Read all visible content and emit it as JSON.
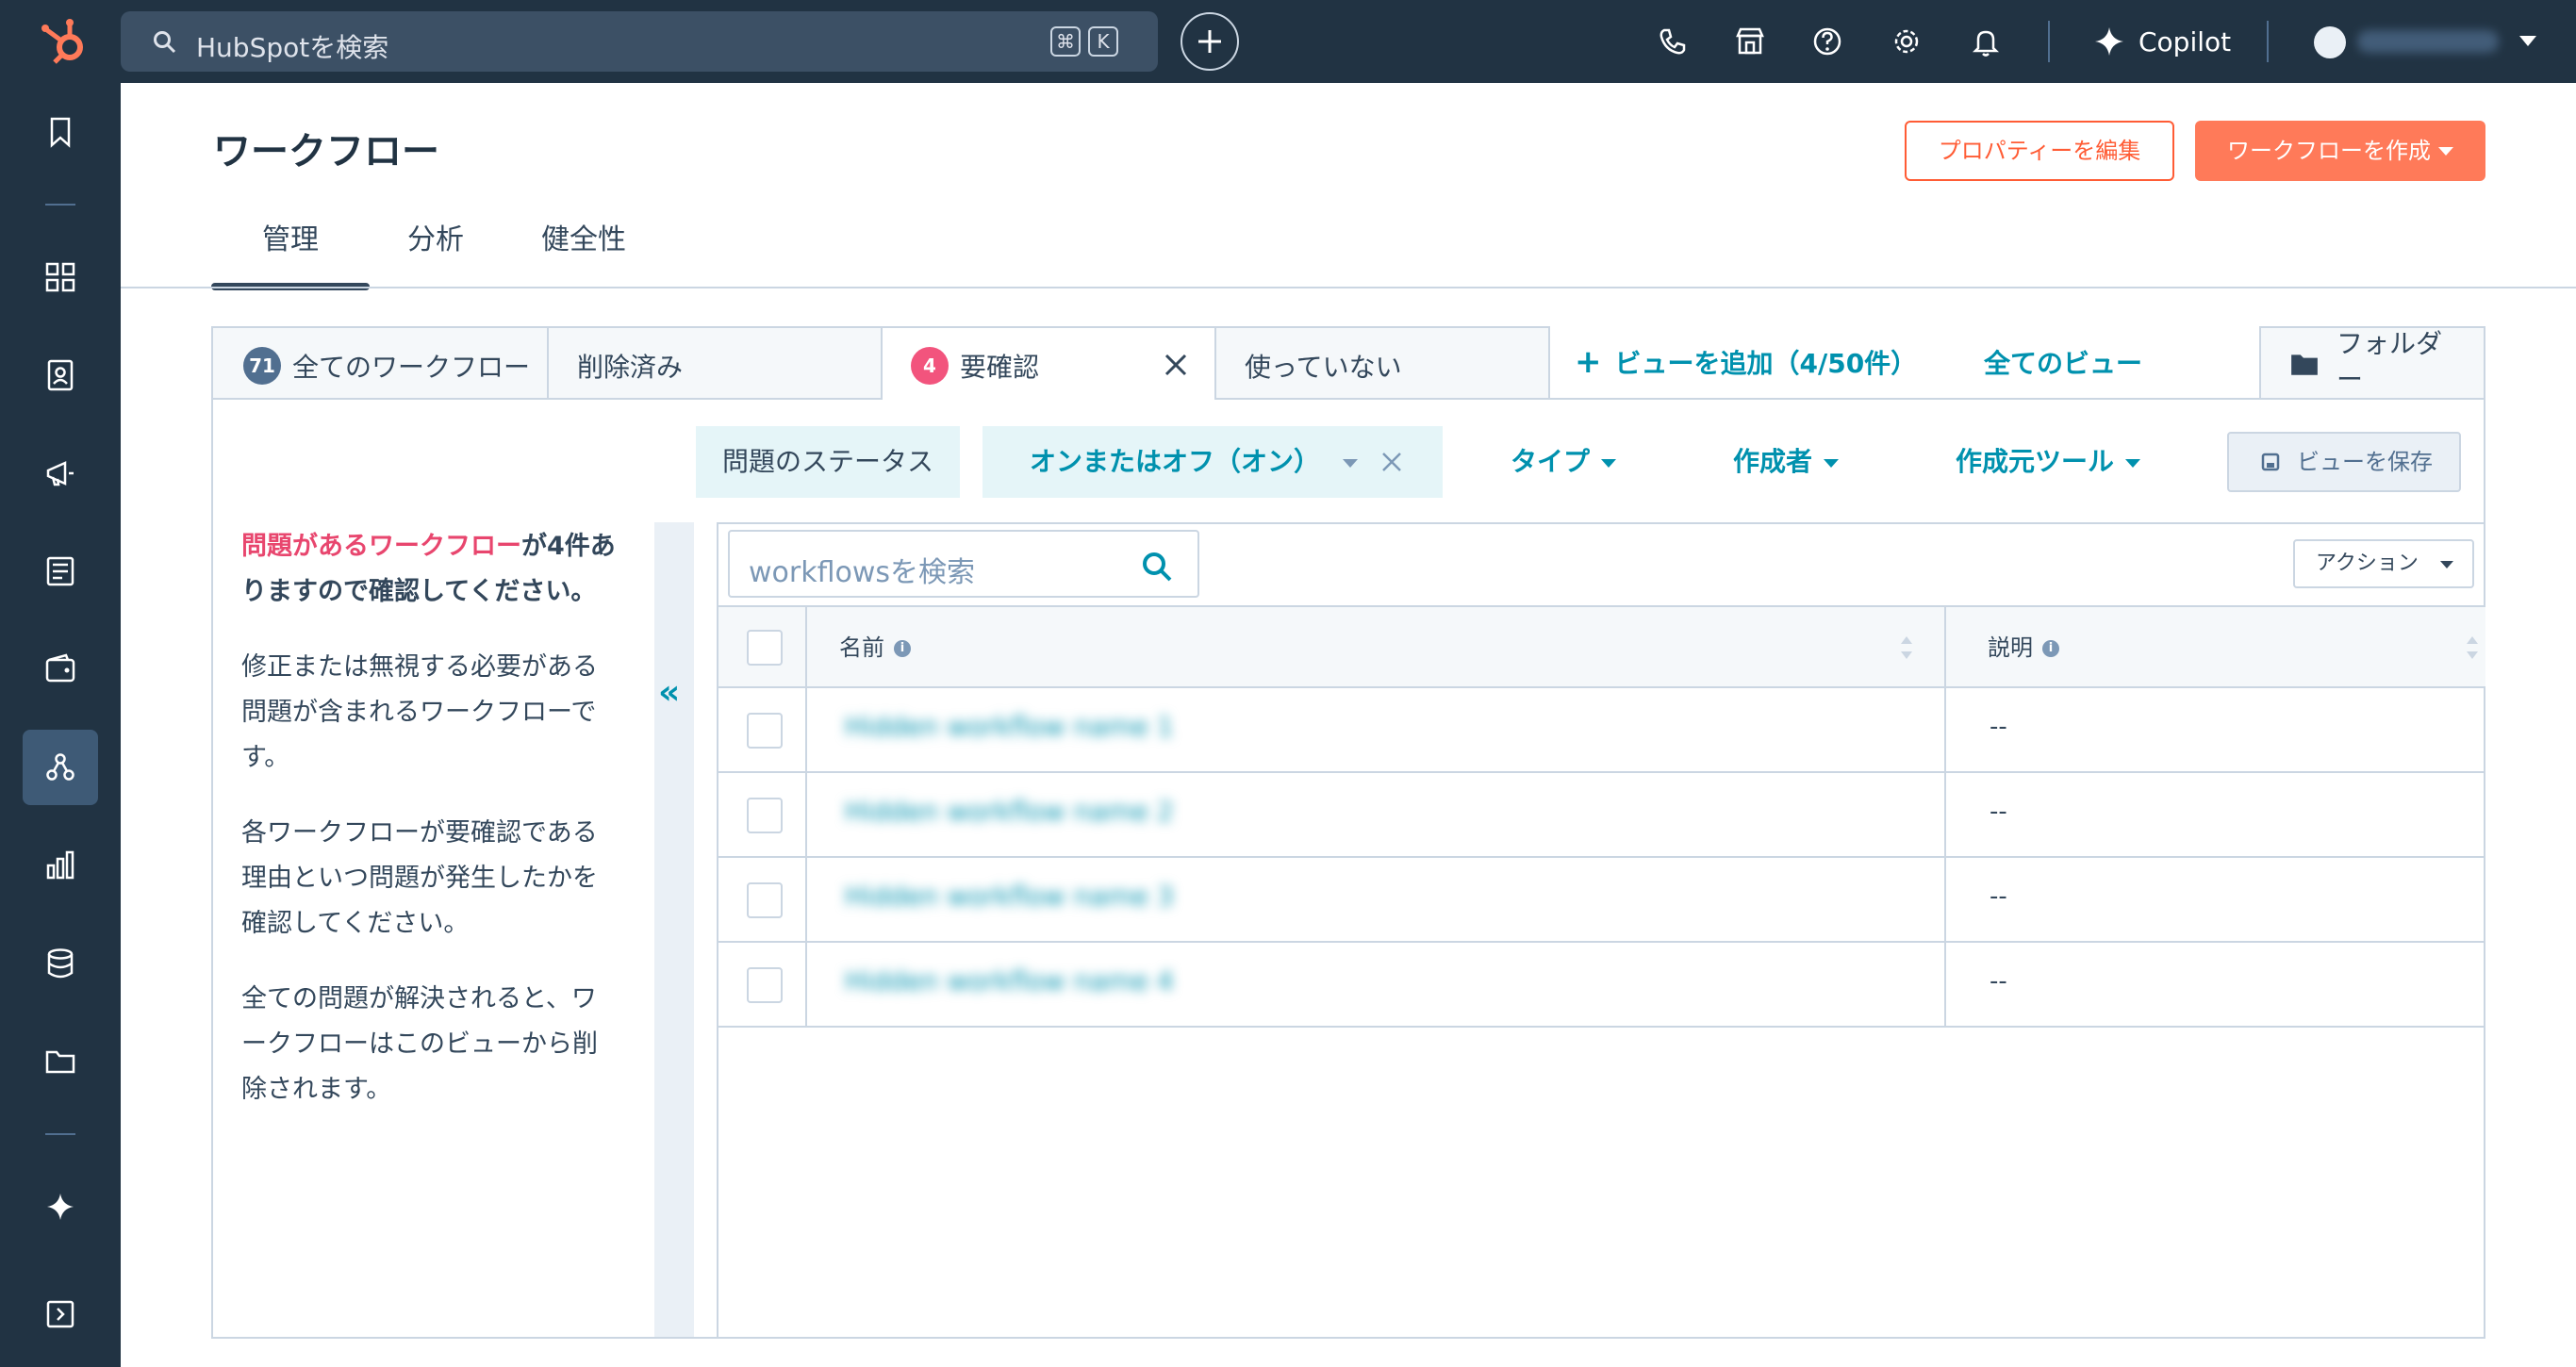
{
  "topbar": {
    "search_placeholder": "HubSpotを検索",
    "shortcut_keys": [
      "⌘",
      "K"
    ],
    "copilot_label": "Copilot",
    "icons": [
      "phone-icon",
      "marketplace-icon",
      "help-icon",
      "settings-icon",
      "notifications-icon"
    ]
  },
  "leftnav": {
    "items": [
      "bookmark-icon",
      "workspaces-icon",
      "contacts-icon",
      "marketing-icon",
      "content-icon",
      "commerce-icon",
      "automation-icon",
      "reporting-icon",
      "data-management-icon",
      "library-icon",
      "breeze-icon",
      "expand-nav-icon"
    ],
    "active": "automation-icon"
  },
  "header": {
    "title": "ワークフロー",
    "edit_properties_label": "プロパティーを編集",
    "create_workflow_label": "ワークフローを作成"
  },
  "main_tabs": [
    {
      "label": "管理",
      "active": true
    },
    {
      "label": "分析",
      "active": false
    },
    {
      "label": "健全性",
      "active": false
    }
  ],
  "view_tabs": [
    {
      "label": "全てのワークフロー",
      "badge": "71"
    },
    {
      "label": "削除済み"
    },
    {
      "label": "要確認",
      "badge": "4",
      "active": true
    },
    {
      "label": "使っていない"
    }
  ],
  "add_view_label": "ビューを追加（4/50件）",
  "all_views_label": "全てのビュー",
  "folder_label": "フォルダー",
  "filters": {
    "issue_status_label": "問題のステータス",
    "on_off_label": "オンまたはオフ（オン）",
    "type_label": "タイプ",
    "creator_label": "作成者",
    "source_tool_label": "作成元ツール",
    "save_view_label": "ビューを保存"
  },
  "info_panel": {
    "headline_em": "問題があるワークフロー",
    "headline_rest": "が4件ありますので確認してください。",
    "paragraph_1": "修正または無視する必要がある問題が含まれるワークフローです。",
    "paragraph_2": "各ワークフローが要確認である理由といつ問題が発生したかを確認してください。",
    "paragraph_3": "全ての問題が解決されると、ワークフローはこのビューから削除されます。"
  },
  "table": {
    "search_placeholder": "workflowsを検索",
    "actions_label": "アクション",
    "columns": [
      "名前",
      "説明"
    ],
    "rows": [
      {
        "name": "Hidden workflow name 1",
        "description": "--"
      },
      {
        "name": "Hidden workflow name 2",
        "description": "--"
      },
      {
        "name": "Hidden workflow name 3",
        "description": "--"
      },
      {
        "name": "Hidden workflow name 4",
        "description": "--"
      }
    ]
  },
  "colors": {
    "topbar": "#213343",
    "accent_orange": "#ff7a59",
    "link_teal": "#0091ae",
    "badge_pink": "#f2547d",
    "badge_gray": "#516f90"
  }
}
